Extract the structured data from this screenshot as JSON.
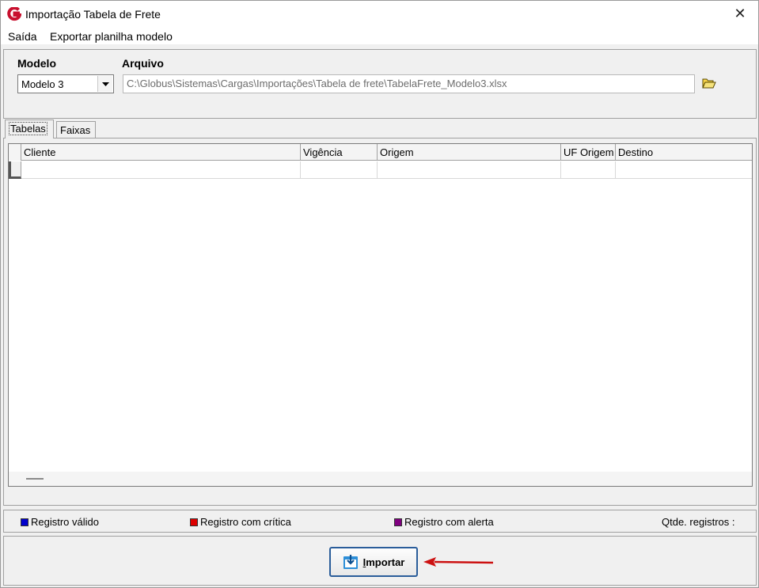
{
  "window": {
    "title": "Importação Tabela de Frete",
    "close_glyph": "✕",
    "app_icon": "globus-logo-icon"
  },
  "menu": {
    "items": [
      "Saída",
      "Exportar planilha modelo"
    ]
  },
  "form": {
    "modelo_label": "Modelo",
    "modelo_value": "Modelo 3",
    "arquivo_label": "Arquivo",
    "arquivo_value": "C:\\Globus\\Sistemas\\Cargas\\Importações\\Tabela de frete\\TabelaFrete_Modelo3.xlsx",
    "folder_icon": "folder-open-icon"
  },
  "tabs": [
    "Tabelas",
    "Faixas"
  ],
  "active_tab": "Tabelas",
  "grid": {
    "columns": [
      "Cliente",
      "Vigência",
      "Origem",
      "UF Origem",
      "Destino"
    ],
    "rows": []
  },
  "legend": {
    "valid": "Registro válido",
    "critical": "Registro com crítica",
    "alert": "Registro com alerta",
    "count_label": "Qtde. registros :",
    "colors": {
      "valid": "#0000cc",
      "critical": "#dd0000",
      "alert": "#800080"
    }
  },
  "actions": {
    "import_prefix": "I",
    "import_rest": "mportar",
    "import_icon": "download-icon"
  },
  "annotation": {
    "arrow_color": "#cc1111"
  }
}
